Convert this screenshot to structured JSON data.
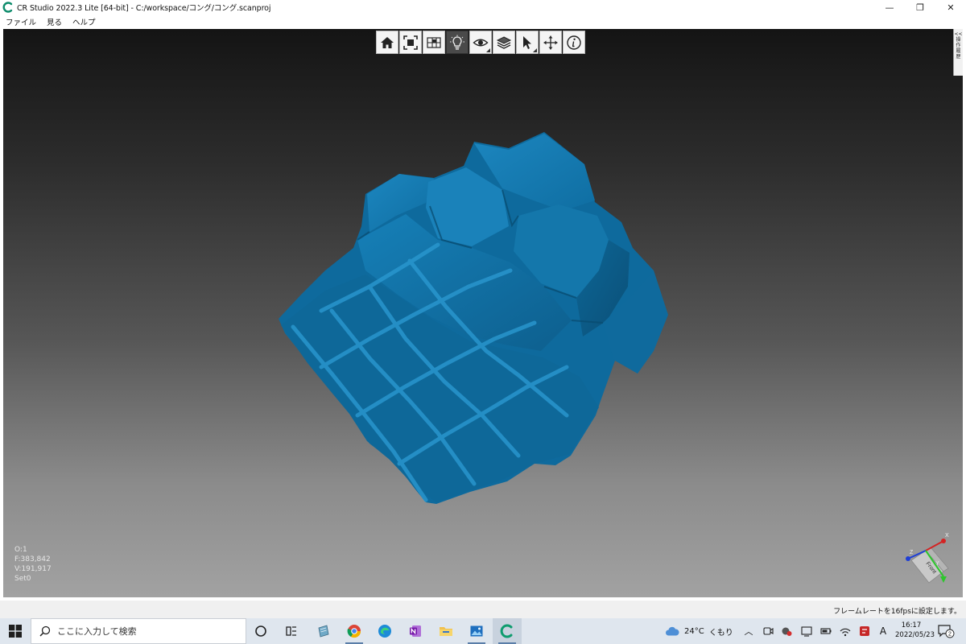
{
  "window": {
    "title": "CR Studio 2022.3 Lite [64-bit] - C:/workspace/コング/コング.scanproj",
    "minimize_glyph": "—",
    "restore_glyph": "❐",
    "close_glyph": "✕"
  },
  "menu": {
    "items": [
      {
        "label": "ファイル"
      },
      {
        "label": "見る"
      },
      {
        "label": "ヘルプ"
      }
    ]
  },
  "toolbar": {
    "buttons": [
      {
        "icon": "home-icon"
      },
      {
        "icon": "fit-view-icon"
      },
      {
        "icon": "view-presets-icon"
      },
      {
        "icon": "light-bulb-icon",
        "active": true
      },
      {
        "icon": "eye-icon"
      },
      {
        "icon": "layers-icon"
      },
      {
        "icon": "cursor-icon"
      },
      {
        "icon": "move-icon"
      },
      {
        "icon": "info-icon"
      }
    ]
  },
  "side_panel": {
    "chars": [
      "<<",
      "操",
      "作",
      "履",
      "歴"
    ]
  },
  "stats": {
    "objects": "O:1",
    "faces": "F:383,842",
    "vertices": "V:191,917",
    "set": "Set0"
  },
  "gizmo": {
    "x_label": "X",
    "y_label": "Y",
    "z_label": "Z",
    "cube_label": "Front",
    "x_color": "#d42323",
    "y_color": "#2cc62c",
    "z_color": "#1f3fd6"
  },
  "model": {
    "color": "#0f6a9c"
  },
  "status": {
    "message": "フレームレートを16fpsに設定します。"
  },
  "taskbar": {
    "search_placeholder": "ここに入力して検索",
    "weather_temp": "24°C",
    "weather_text": "くもり",
    "ime": "A",
    "time": "16:17",
    "date": "2022/05/23",
    "notification_count": "2"
  }
}
